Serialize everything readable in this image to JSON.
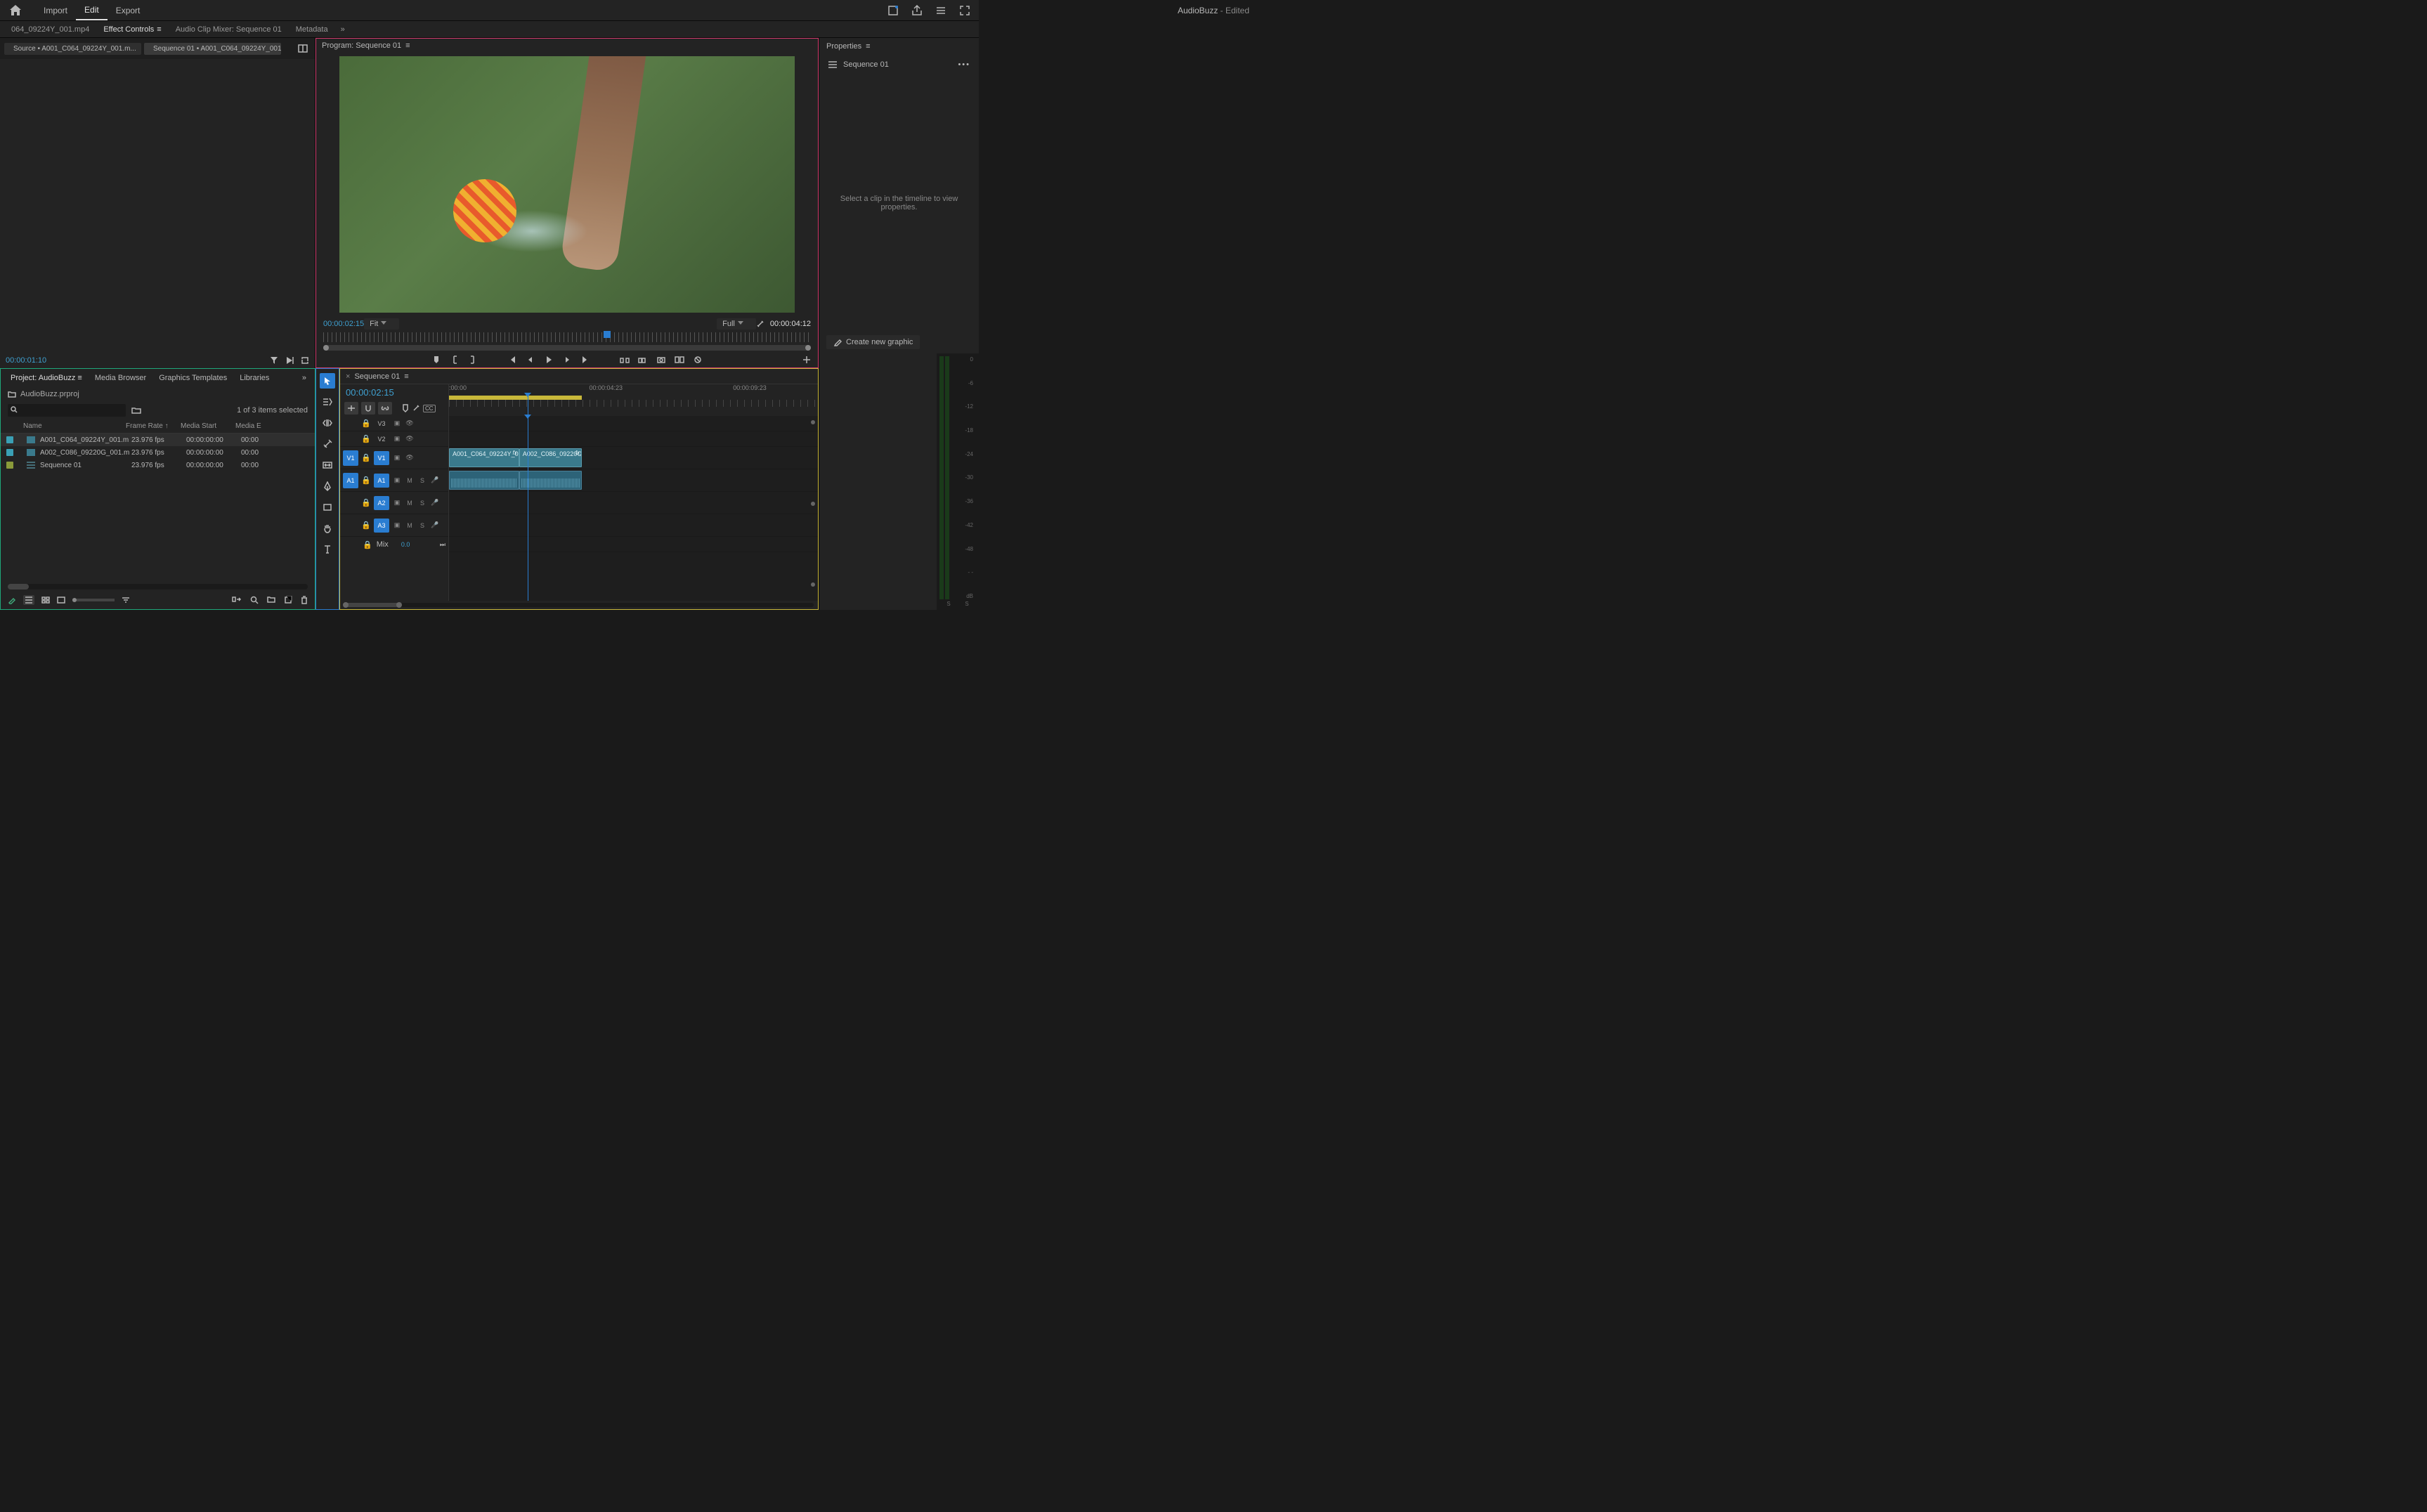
{
  "menu": {
    "import": "Import",
    "edit": "Edit",
    "export": "Export"
  },
  "app_title": {
    "name": "AudioBuzz",
    "suffix": " - Edited"
  },
  "source_tabs": {
    "t0": "064_09224Y_001.mp4",
    "t1": "Effect Controls",
    "t2": "Audio Clip Mixer: Sequence 01",
    "t3": "Metadata"
  },
  "src_sub_tabs": {
    "a": "Source • A001_C064_09224Y_001.m...",
    "b": "Sequence 01 • A001_C064_09224Y_001.m..."
  },
  "source_tc": "00:00:01:10",
  "program": {
    "title": "Program: Sequence 01",
    "tc_left": "00:00:02:15",
    "fit": "Fit",
    "quality": "Full",
    "tc_right": "00:00:04:12"
  },
  "props": {
    "title": "Properties",
    "seq_name": "Sequence 01",
    "empty_msg": "Select a clip in the timeline to view properties.",
    "create_graphic": "Create new graphic"
  },
  "project": {
    "tabs": {
      "proj": "Project: AudioBuzz",
      "mb": "Media Browser",
      "gt": "Graphics Templates",
      "lib": "Libraries"
    },
    "file": "AudioBuzz.prproj",
    "sel": "1 of 3 items selected",
    "cols": {
      "name": "Name",
      "fr": "Frame Rate ↑",
      "ms": "Media Start",
      "me": "Media E"
    },
    "rows": [
      {
        "swatch": "#3aa0b5",
        "name": "A001_C064_09224Y_001.m",
        "fr": "23.976 fps",
        "ms": "00:00:00:00",
        "me": "00:00"
      },
      {
        "swatch": "#3aa0b5",
        "name": "A002_C086_09220G_001.m",
        "fr": "23.976 fps",
        "ms": "00:00:00:00",
        "me": "00:00"
      },
      {
        "swatch": "#8a9a3a",
        "name": "Sequence 01",
        "fr": "23.976 fps",
        "ms": "00:00:00:00",
        "me": "00:00"
      }
    ]
  },
  "timeline": {
    "seq": "Sequence 01",
    "tc": "00:00:02:15",
    "ruler": {
      "t0": ":00:00",
      "t1": "00:00:04:23",
      "t2": "00:00:09:23"
    },
    "tracks": {
      "v3": "V3",
      "v2": "V2",
      "v1": "V1",
      "a1": "A1",
      "a2": "A2",
      "a3": "A3",
      "mix": "Mix"
    },
    "clips": {
      "v1a": "A001_C064_09224Y_0...",
      "v1b": "A002_C086_09220G...",
      "fx": "fx"
    },
    "mix_val": "0.0"
  },
  "meters": {
    "scale": [
      "0",
      "-6",
      "-12",
      "-18",
      "-24",
      "-30",
      "-36",
      "-42",
      "-48",
      "- -",
      "dB"
    ],
    "solo": "S"
  },
  "search_placeholder": ""
}
